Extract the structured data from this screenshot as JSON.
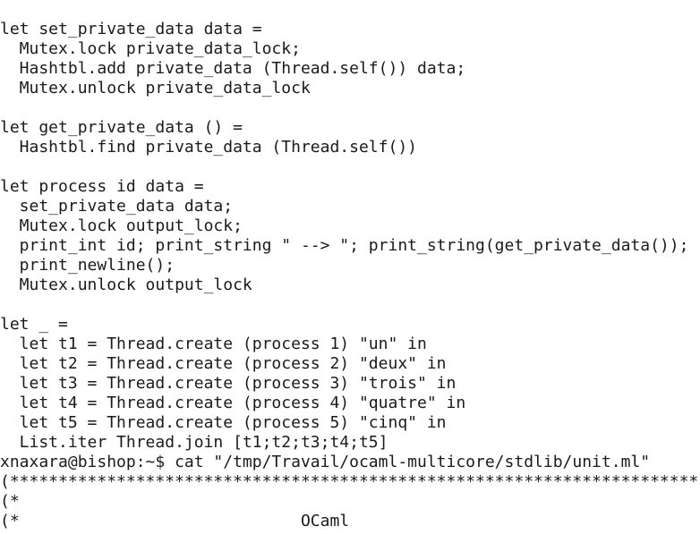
{
  "terminal": {
    "lines": [
      "let set_private_data data =",
      "  Mutex.lock private_data_lock;",
      "  Hashtbl.add private_data (Thread.self()) data;",
      "  Mutex.unlock private_data_lock",
      "",
      "let get_private_data () =",
      "  Hashtbl.find private_data (Thread.self())",
      "",
      "let process id data =",
      "  set_private_data data;",
      "  Mutex.lock output_lock;",
      "  print_int id; print_string \" --> \"; print_string(get_private_data());",
      "  print_newline();",
      "  Mutex.unlock output_lock",
      "",
      "let _ =",
      "  let t1 = Thread.create (process 1) \"un\" in",
      "  let t2 = Thread.create (process 2) \"deux\" in",
      "  let t3 = Thread.create (process 3) \"trois\" in",
      "  let t4 = Thread.create (process 4) \"quatre\" in",
      "  let t5 = Thread.create (process 5) \"cinq\" in",
      "  List.iter Thread.join [t1;t2;t3;t4;t5]",
      "xnaxara@bishop:~$ cat \"/tmp/Travail/ocaml-multicore/stdlib/unit.ml\"",
      "(*************************************************************************",
      "(*",
      "(*                             OCaml"
    ]
  }
}
